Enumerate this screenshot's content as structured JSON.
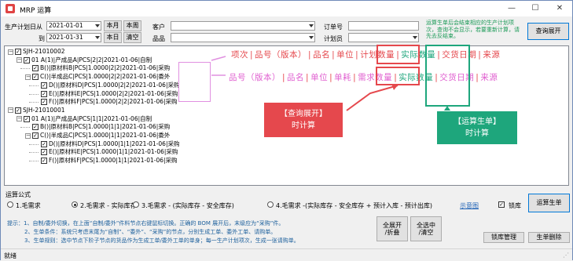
{
  "window": {
    "title": "MRP 运算",
    "minimize": "—",
    "maximize": "☐",
    "close": "✕"
  },
  "filters": {
    "plan_date_label": "生产计划日从",
    "date_from": "2021-01-01",
    "to_label": "到",
    "date_to": "2021-01-31",
    "this_month": "本月",
    "this_week": "本周",
    "today": "本日",
    "clear": "清空",
    "customer_label": "客户",
    "customer_value": "",
    "item_label": "品品",
    "item_value": "",
    "order_label": "订单号",
    "order_value": "",
    "planner_label": "计划员",
    "planner_value": "",
    "query_expand": "查询展开",
    "hint": "运算生单后会结束相应的生产计划项次，查询不会显示，若要重新计算，请先去反结束。"
  },
  "tree": {
    "orders": [
      {
        "code": "SJH-21010002",
        "items": [
          {
            "text": "01 A(1)|产成品A|PCS|2|2|2021-01-06|自制",
            "children": [
              {
                "text": "B()|原材料B|PCS|1.0000|2|2|2021-01-06|采购"
              },
              {
                "text": "C()|半成品C|PCS|1.0000|2|2|2021-01-06|委外",
                "children": [
                  {
                    "text": "D()|原材料D|PCS|1.0000|2|2|2021-01-06|采购"
                  },
                  {
                    "text": "E()|原材料E|PCS|1.0000|2|2|2021-01-06|采购"
                  },
                  {
                    "text": "F()|原材料F|PCS|1.0000|2|2|2021-01-06|采购"
                  }
                ]
              }
            ]
          }
        ]
      },
      {
        "code": "SJH-21010001",
        "items": [
          {
            "text": "01 A(1)|产成品A|PCS|1|1|2021-01-06|自制",
            "children": [
              {
                "text": "B()|原材料B|PCS|1.0000|1|1|2021-01-06|采购"
              },
              {
                "text": "C()|半成品C|PCS|1.0000|1|1|2021-01-06|委外",
                "children": [
                  {
                    "text": "D()|原材料D|PCS|1.0000|1|1|2021-01-06|采购"
                  },
                  {
                    "text": "E()|原材料E|PCS|1.0000|1|1|2021-01-06|采购"
                  },
                  {
                    "text": "F()|原材料F|PCS|1.0000|1|1|2021-01-06|采购"
                  }
                ]
              }
            ]
          }
        ]
      }
    ]
  },
  "annotations": {
    "row1": [
      "项次",
      "|",
      "品号（版本）",
      "|",
      "品名",
      "|",
      "单位",
      "|",
      "计划数量",
      "|",
      "实际数量",
      "|",
      "交货日期",
      "|",
      "来源"
    ],
    "row2": [
      "品号（版本）",
      "|",
      "品名",
      "|",
      "单位",
      "|",
      "单耗",
      "|",
      "需求数量",
      "|",
      "实际数量",
      "|",
      "交货日期",
      "|",
      "来源"
    ],
    "callout_red": [
      "【查询展开】",
      "时计算"
    ],
    "callout_green": [
      "【运算生单】",
      "时计算"
    ]
  },
  "formula": {
    "title": "运算公式",
    "options": [
      "1.毛需求",
      "2.毛需求 - 实际库存",
      "3.毛需求 - (实际库存 - 安全库存)",
      "4.毛需求 -(实际库存 - 安全库存 + 预计入库 - 预计出库)"
    ],
    "selected_index": 1,
    "diagram_link": "示意图",
    "lock_label": "锁库",
    "run_button": "运算生单"
  },
  "tips": [
    "提示：1、自制/委外切换，在上面“自制/委外”件料节点右键鼠标切换。正确的 BOM 展开后，末级应为“采购”件。",
    "2、生单条件：系统只考虑末尾为“自制”、“委外”、“采购”的节点，分别生成工单、委外工单、请购单。",
    "3、生单规则：选中节点下阶子节点的货品作为生成工单/委外工单的单身；每一生产计划项次，生成一张请购单。"
  ],
  "actions": {
    "expand_collapse": [
      "全展开",
      "/折叠"
    ],
    "select_all": [
      "全选中",
      "/清空"
    ],
    "lock_manage": "锁库管理",
    "delete_order": "生单删除"
  },
  "status": {
    "text": "就绪"
  }
}
